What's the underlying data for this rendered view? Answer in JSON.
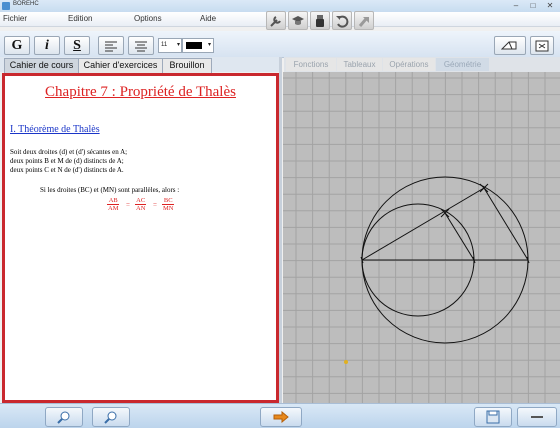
{
  "window": {
    "title": "BOREHC",
    "min": "–",
    "max": "□",
    "close": "✕"
  },
  "menu": {
    "file": "Fichier",
    "edit": "Edition",
    "options": "Options",
    "help": "Aide"
  },
  "format": {
    "bold": "G",
    "italic": "i",
    "underline": "S",
    "size": "11",
    "caret": "▾"
  },
  "left_tabs": [
    "Cahier de cours",
    "Cahier d'exercices",
    "Brouillon"
  ],
  "right_tabs": [
    "Fonctions",
    "Tableaux",
    "Opérations",
    "Géométrie"
  ],
  "lesson": {
    "chapter": "Chapitre 7 : Propriété de Thalès",
    "section": "I. Théorème de Thalès",
    "lines": [
      "Soit deux droites (d) et (d') sécantes en A;",
      "deux points B et M de (d) distincts de A;",
      "deux points C et N de (d') distincts de A."
    ],
    "if_line": "Si les droites (BC) et (MN) sont parallèles, alors :",
    "fractions": [
      {
        "num": "AB",
        "den": "AM"
      },
      {
        "num": "AC",
        "den": "AN"
      },
      {
        "num": "BC",
        "den": "MN"
      }
    ],
    "eq": "="
  },
  "colors": {
    "accent": "#c9282e",
    "link": "#1a35c8",
    "grid_bg": "#bdbdbd",
    "grid_line": "#a3a3a3"
  },
  "icons": {
    "toolbar": [
      "wrench-icon",
      "graduation-cap-icon",
      "usb-key-icon",
      "undo-icon",
      "redo-icon"
    ],
    "bottom": [
      "zoom-in-icon",
      "zoom-out-icon",
      "arrow-right-icon",
      "save-icon",
      "minus-icon"
    ]
  }
}
